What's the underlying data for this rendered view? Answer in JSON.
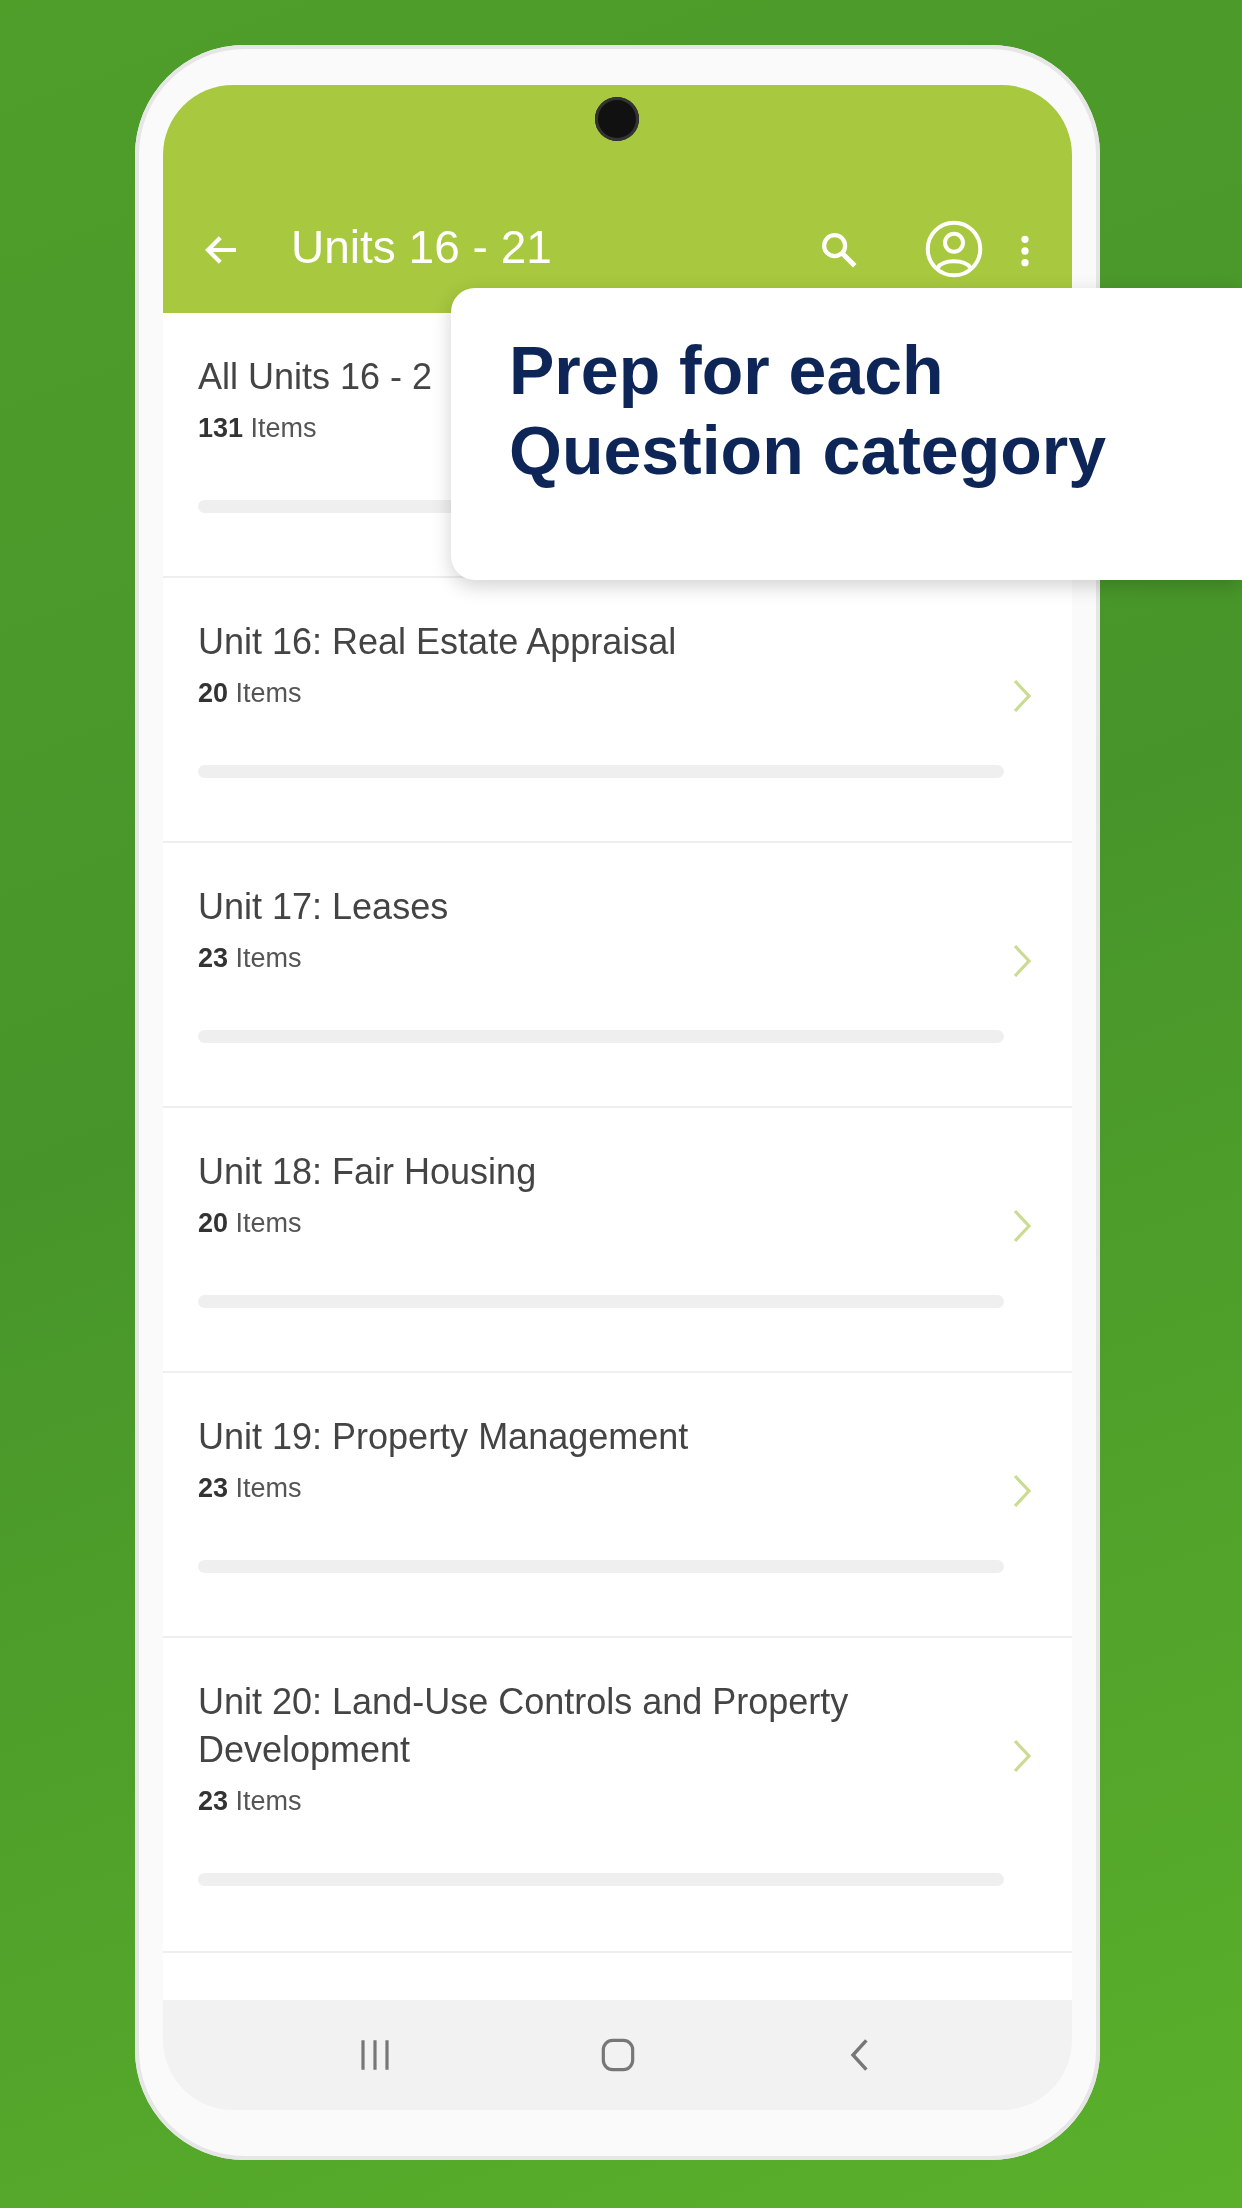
{
  "app_bar": {
    "title": "Units 16 - 21"
  },
  "units": [
    {
      "title": "All Units 16 - 2",
      "count": "131",
      "count_label": "Items",
      "chevron": false
    },
    {
      "title": "Unit 16: Real Estate Appraisal",
      "count": "20",
      "count_label": "Items",
      "chevron": true
    },
    {
      "title": "Unit 17: Leases",
      "count": "23",
      "count_label": "Items",
      "chevron": true
    },
    {
      "title": "Unit 18: Fair Housing",
      "count": "20",
      "count_label": "Items",
      "chevron": true
    },
    {
      "title": "Unit 19: Property Management",
      "count": "23",
      "count_label": "Items",
      "chevron": true
    },
    {
      "title": "Unit 20: Land-Use Controls and Property Development",
      "count": "23",
      "count_label": "Items",
      "chevron": true
    }
  ],
  "callout": {
    "text": "Prep for each Question category"
  }
}
